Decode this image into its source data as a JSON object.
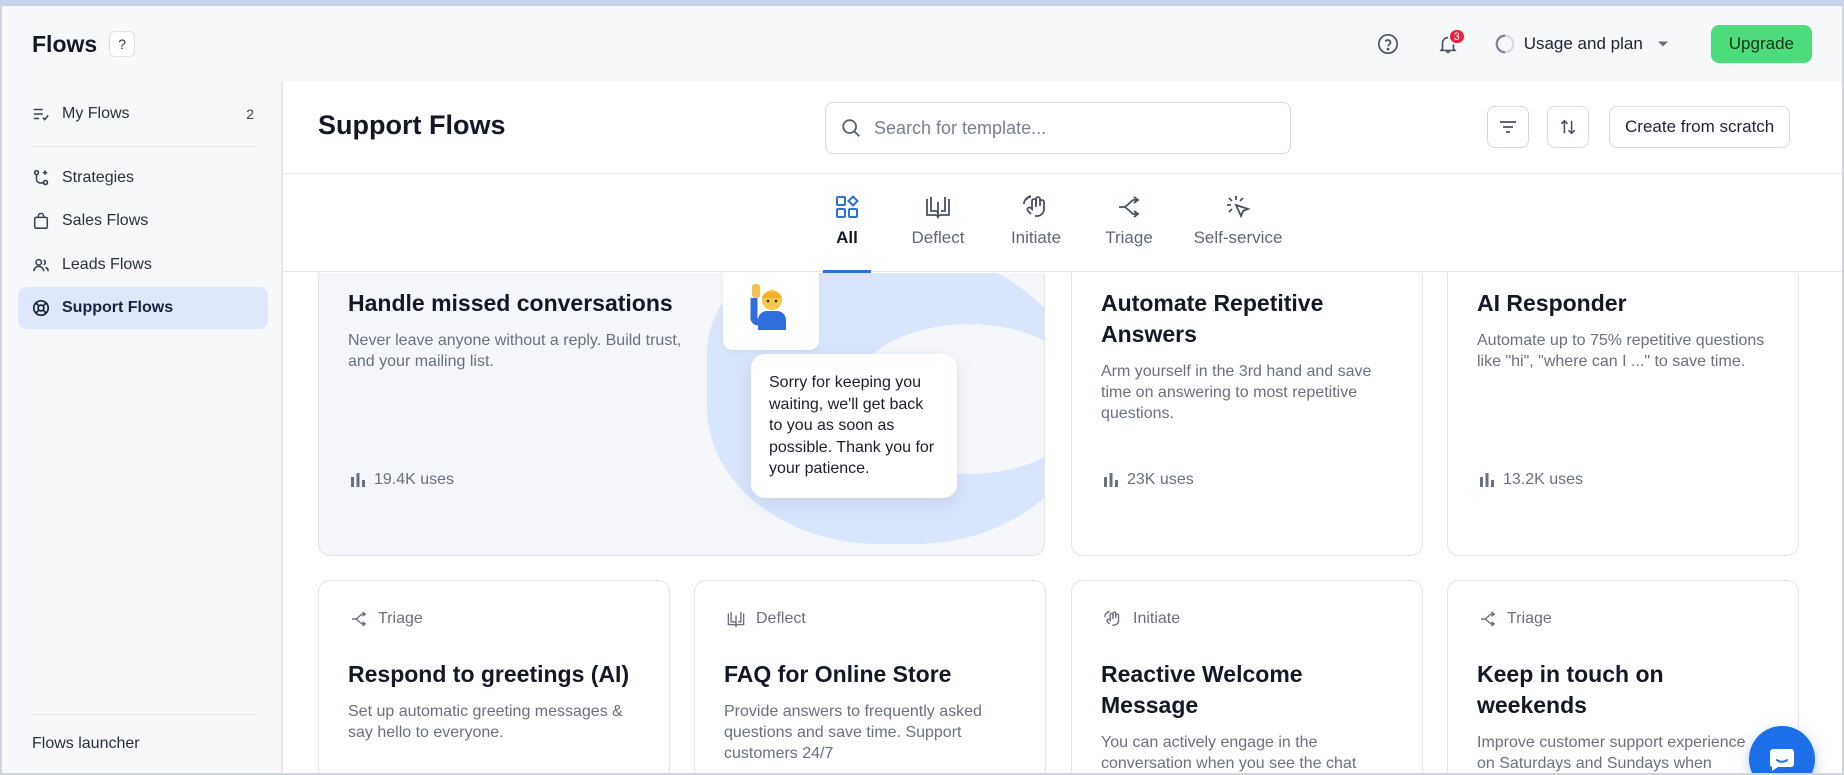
{
  "app": {
    "title": "Flows",
    "help_chip": "?"
  },
  "topbar": {
    "help_icon": "question-circle-icon",
    "notifications_count": "3",
    "usage_label": "Usage and plan",
    "upgrade_label": "Upgrade"
  },
  "sidebar": {
    "items": [
      {
        "label": "My Flows",
        "count": "2",
        "icon": "list-check-icon"
      },
      {
        "label": "Strategies",
        "icon": "strategy-icon"
      },
      {
        "label": "Sales Flows",
        "icon": "shopping-bag-icon"
      },
      {
        "label": "Leads Flows",
        "icon": "users-icon"
      },
      {
        "label": "Support Flows",
        "icon": "lifebuoy-icon"
      }
    ],
    "launcher": "Flows launcher"
  },
  "main": {
    "title": "Support Flows",
    "search_placeholder": "Search for template...",
    "create_label": "Create from scratch",
    "tabs": [
      {
        "label": "All"
      },
      {
        "label": "Deflect"
      },
      {
        "label": "Initiate"
      },
      {
        "label": "Triage"
      },
      {
        "label": "Self-service"
      }
    ]
  },
  "cards": {
    "featured": {
      "title": "Handle missed conversations",
      "desc": "Never leave anyone without a reply. Build trust, and your mailing list.",
      "uses": "19.4K uses",
      "bubble": "Sorry for keeping you waiting, we'll get back to you as soon as possible. Thank you for your patience."
    },
    "automate": {
      "title": "Automate Repetitive Answers",
      "desc": "Arm yourself in the 3rd hand and save time on answering to most repetitive questions.",
      "uses": "23K uses"
    },
    "responder": {
      "title": "AI Responder",
      "desc": "Automate up to 75% repetitive questions like \"hi\", \"where can I ...\" to save time.",
      "uses": "13.2K uses"
    },
    "greetings": {
      "tag": "Triage",
      "title": "Respond to greetings (AI)",
      "desc": "Set up automatic greeting messages & say hello to everyone."
    },
    "faq": {
      "tag": "Deflect",
      "title": "FAQ for Online Store",
      "desc": "Provide answers to frequently asked questions and save time. Support customers 24/7"
    },
    "welcome": {
      "tag": "Initiate",
      "title": "Reactive Welcome Message",
      "desc": "You can actively engage in the conversation when you see the chat has..."
    },
    "weekends": {
      "tag": "Triage",
      "title": "Keep in touch on weekends",
      "desc": "Improve customer support experience on Saturdays and Sundays when you're offline..."
    }
  },
  "colors": {
    "accent": "#2f6fdd",
    "upgrade": "#4ddc7a",
    "badge": "#e8213c",
    "active_nav": "#dde8fb"
  }
}
